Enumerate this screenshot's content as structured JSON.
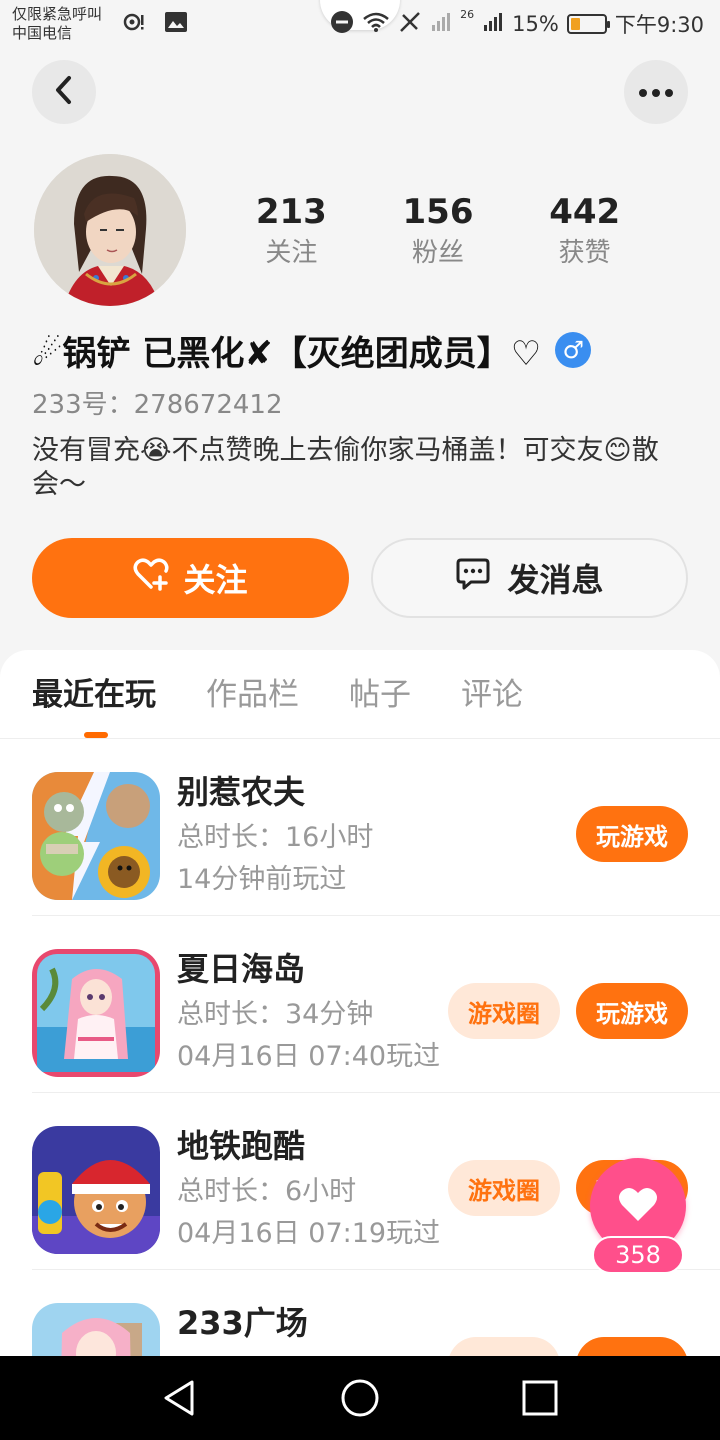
{
  "status_bar": {
    "carrier_line1": "仅限紧急呼叫",
    "carrier_line2": "中国电信",
    "network": "26",
    "battery": "15%",
    "time": "下午9:30"
  },
  "header": {
    "back_icon": "chevron-left-icon",
    "more_icon": "more-horizontal-icon"
  },
  "profile": {
    "username": "☄锅铲 已黑化✘【灭绝团成员】♡",
    "gender_symbol": "♂",
    "user_id": "233号：278672412",
    "bio": "没有冒充😭不点赞晚上去偷你家马桶盖！可交友😊散会～",
    "stats": [
      {
        "value": "213",
        "label": "关注"
      },
      {
        "value": "156",
        "label": "粉丝"
      },
      {
        "value": "442",
        "label": "获赞"
      }
    ],
    "follow_label": "关注",
    "message_label": "发消息"
  },
  "tabs": [
    {
      "label": "最近在玩",
      "active": true
    },
    {
      "label": "作品栏",
      "active": false
    },
    {
      "label": "帖子",
      "active": false
    },
    {
      "label": "评论",
      "active": false
    }
  ],
  "games": [
    {
      "name": "别惹农夫",
      "duration": "总时长：16小时",
      "last_played": "14分钟前玩过",
      "play_label": "玩游戏",
      "circle_label": ""
    },
    {
      "name": "夏日海岛",
      "duration": "总时长：34分钟",
      "last_played": "04月16日 07:40玩过",
      "play_label": "玩游戏",
      "circle_label": "游戏圈"
    },
    {
      "name": "地铁跑酷",
      "duration": "总时长：6小时",
      "last_played": "04月16日 07:19玩过",
      "play_label": "玩游戏",
      "circle_label": "游戏圈"
    },
    {
      "name": "233广场",
      "duration": "",
      "last_played": "",
      "play_label": "",
      "circle_label": ""
    }
  ],
  "floating_like": {
    "count": "358"
  },
  "colors": {
    "accent": "#ff7210",
    "like_pink": "#ff4f8b",
    "male_blue": "#3a8ef0"
  }
}
